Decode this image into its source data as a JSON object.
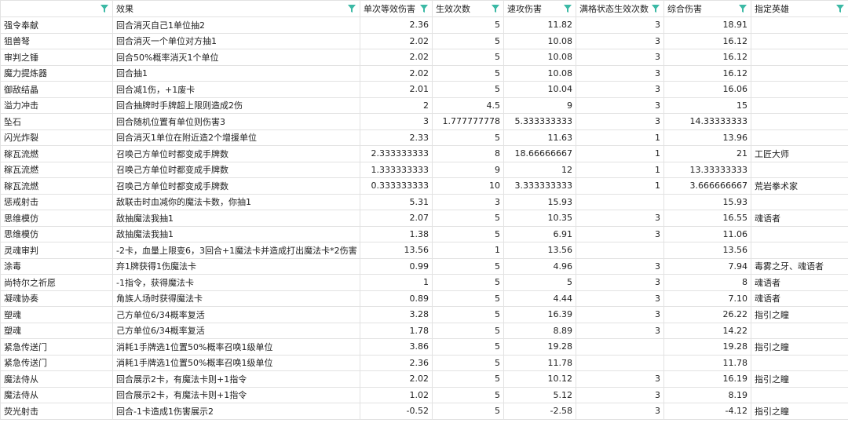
{
  "columns": [
    {
      "label": "",
      "filter_icon": "filter-icon"
    },
    {
      "label": "效果",
      "filter_icon": "filter-icon"
    },
    {
      "label": "单次等效伤害",
      "filter_icon": "filter-icon"
    },
    {
      "label": "生效次数",
      "filter_icon": "filter-icon"
    },
    {
      "label": "速攻伤害",
      "filter_icon": "filter-icon"
    },
    {
      "label": "满格状态生效次数",
      "filter_icon": "filter-icon"
    },
    {
      "label": "综合伤害",
      "filter_icon": "filter-icon"
    },
    {
      "label": "指定英雄",
      "filter_icon": "filter-icon"
    }
  ],
  "filter_color": "#3cb9a5",
  "rows": [
    [
      "强令奉献",
      "回合消灭自己1单位抽2",
      "2.36",
      "5",
      "11.82",
      "3",
      "18.91",
      ""
    ],
    [
      "狙兽弩",
      "回合消灭一个单位对方抽1",
      "2.02",
      "5",
      "10.08",
      "3",
      "16.12",
      ""
    ],
    [
      "审判之锤",
      "回合50%概率消灭1个单位",
      "2.02",
      "5",
      "10.08",
      "3",
      "16.12",
      ""
    ],
    [
      "魔力提炼器",
      "回合抽1",
      "2.02",
      "5",
      "10.08",
      "3",
      "16.12",
      ""
    ],
    [
      "御敌结晶",
      "回合减1伤，+1废卡",
      "2.01",
      "5",
      "10.04",
      "3",
      "16.06",
      ""
    ],
    [
      "溢力冲击",
      "回合抽牌时手牌超上限则造成2伤",
      "2",
      "4.5",
      "9",
      "3",
      "15",
      ""
    ],
    [
      "坠石",
      "回合随机位置有单位则伤害3",
      "3",
      "1.777777778",
      "5.333333333",
      "3",
      "14.33333333",
      ""
    ],
    [
      "闪光炸裂",
      "回合消灭1单位在附近造2个增援单位",
      "2.33",
      "5",
      "11.63",
      "1",
      "13.96",
      ""
    ],
    [
      "稼瓦流燃",
      "召唤己方单位时都变成手牌数",
      "2.333333333",
      "8",
      "18.66666667",
      "1",
      "21",
      "工匠大师"
    ],
    [
      "稼瓦流燃",
      "召唤己方单位时都变成手牌数",
      "1.333333333",
      "9",
      "12",
      "1",
      "13.33333333",
      ""
    ],
    [
      "稼瓦流燃",
      "召唤己方单位时都变成手牌数",
      "0.333333333",
      "10",
      "3.333333333",
      "1",
      "3.666666667",
      "荒岩拳术家"
    ],
    [
      "惩戒射击",
      "敌联击时血减你的魔法卡数，你抽1",
      "5.31",
      "3",
      "15.93",
      "",
      "15.93",
      ""
    ],
    [
      "思维模仿",
      "敌抽魔法我抽1",
      "2.07",
      "5",
      "10.35",
      "3",
      "16.55",
      "魂语者"
    ],
    [
      "思维模仿",
      "敌抽魔法我抽1",
      "1.38",
      "5",
      "6.91",
      "3",
      "11.06",
      ""
    ],
    [
      "灵魂审判",
      "-2卡，血量上限变6，3回合+1魔法卡并造成打出魔法卡*2伤害",
      "13.56",
      "1",
      "13.56",
      "",
      "13.56",
      ""
    ],
    [
      "涂毒",
      "弃1牌获得1伤魔法卡",
      "0.99",
      "5",
      "4.96",
      "3",
      "7.94",
      "毒雾之牙、魂语者"
    ],
    [
      "尚特尔之祈愿",
      "-1指令，获得魔法卡",
      "1",
      "5",
      "5",
      "3",
      "8",
      "魂语者"
    ],
    [
      "凝魂协奏",
      "角族人场时获得魔法卡",
      "0.89",
      "5",
      "4.44",
      "3",
      "7.10",
      "魂语者"
    ],
    [
      "塑魂",
      "己方单位6/34概率复活",
      "3.28",
      "5",
      "16.39",
      "3",
      "26.22",
      "指引之瞳"
    ],
    [
      "塑魂",
      "己方单位6/34概率复活",
      "1.78",
      "5",
      "8.89",
      "3",
      "14.22",
      ""
    ],
    [
      "紧急传送门",
      "消耗1手牌选1位置50%概率召唤1级单位",
      "3.86",
      "5",
      "19.28",
      "",
      "19.28",
      "指引之瞳"
    ],
    [
      "紧急传送门",
      "消耗1手牌选1位置50%概率召唤1级单位",
      "2.36",
      "5",
      "11.78",
      "",
      "11.78",
      ""
    ],
    [
      "魔法侍从",
      "回合展示2卡，有魔法卡则+1指令",
      "2.02",
      "5",
      "10.12",
      "3",
      "16.19",
      "指引之瞳"
    ],
    [
      "魔法侍从",
      "回合展示2卡，有魔法卡则+1指令",
      "1.02",
      "5",
      "5.12",
      "3",
      "8.19",
      ""
    ],
    [
      "荧光射击",
      "回合-1卡造成1伤害展示2",
      "-0.52",
      "5",
      "-2.58",
      "3",
      "-4.12",
      "指引之瞳"
    ]
  ]
}
